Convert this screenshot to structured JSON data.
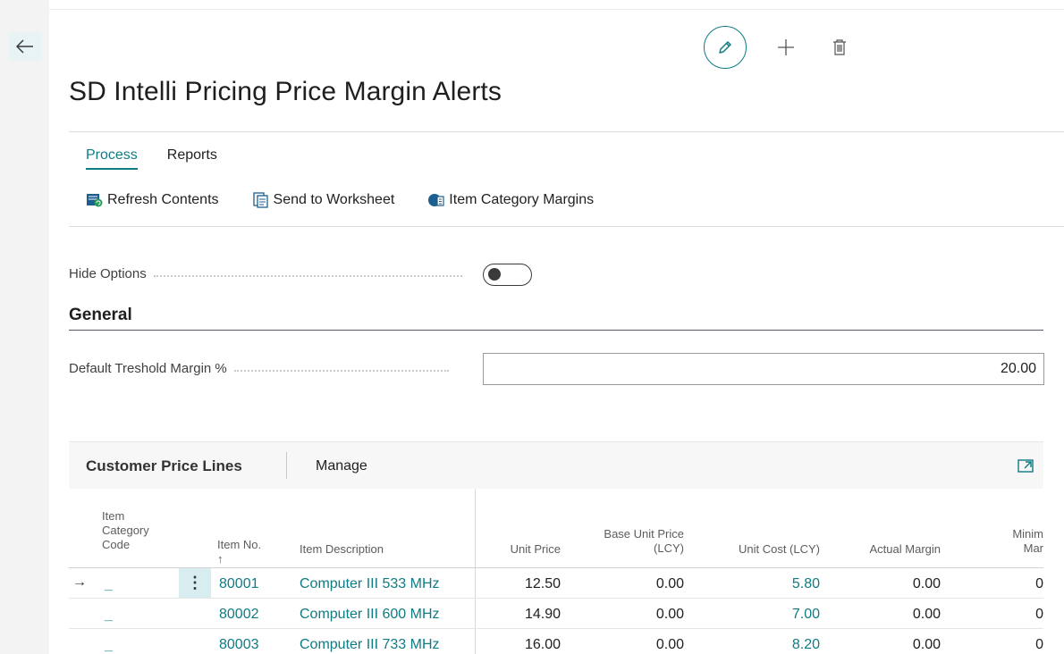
{
  "page": {
    "title": "SD Intelli Pricing Price Margin Alerts"
  },
  "icons": {
    "back": "arrow-left-icon",
    "edit": "pencil-icon",
    "new": "plus-icon",
    "delete": "trash-icon",
    "refresh": "refresh-contents-icon",
    "send": "send-to-worksheet-icon",
    "category": "item-category-icon",
    "expand": "expand-icon"
  },
  "colors": {
    "accent": "#0f7b83",
    "text": "#212121"
  },
  "menu": {
    "tabs": [
      "Process",
      "Reports"
    ],
    "actions": [
      "Refresh Contents",
      "Send to Worksheet",
      "Item Category Margins"
    ]
  },
  "options": {
    "hide_options_label": "Hide Options",
    "hide_options_on": false
  },
  "general": {
    "section_title": "General",
    "threshold_label": "Default Treshold Margin %",
    "threshold_value": "20.00"
  },
  "lines": {
    "title": "Customer Price Lines",
    "manage_label": "Manage",
    "columns": {
      "item_category_code": [
        "Item",
        "Category",
        "Code"
      ],
      "item_no": [
        "Item No.",
        "↑"
      ],
      "item_description": "Item Description",
      "unit_price": "Unit Price",
      "base_unit_price": [
        "Base Unit Price",
        "(LCY)"
      ],
      "unit_cost": "Unit Cost (LCY)",
      "actual_margin": "Actual Margin",
      "minimum_margin": [
        "Minim",
        "Mar"
      ]
    },
    "rows": [
      {
        "category": "_",
        "item_no": "80001",
        "description": "Computer III 533 MHz",
        "unit_price": "12.50",
        "base_unit_price": "0.00",
        "unit_cost": "5.80",
        "actual_margin": "0.00",
        "min_margin": "0",
        "current": true
      },
      {
        "category": "_",
        "item_no": "80002",
        "description": "Computer III 600 MHz",
        "unit_price": "14.90",
        "base_unit_price": "0.00",
        "unit_cost": "7.00",
        "actual_margin": "0.00",
        "min_margin": "0",
        "current": false
      },
      {
        "category": "_",
        "item_no": "80003",
        "description": "Computer III 733 MHz",
        "unit_price": "16.00",
        "base_unit_price": "0.00",
        "unit_cost": "8.20",
        "actual_margin": "0.00",
        "min_margin": "0",
        "current": false
      }
    ]
  }
}
